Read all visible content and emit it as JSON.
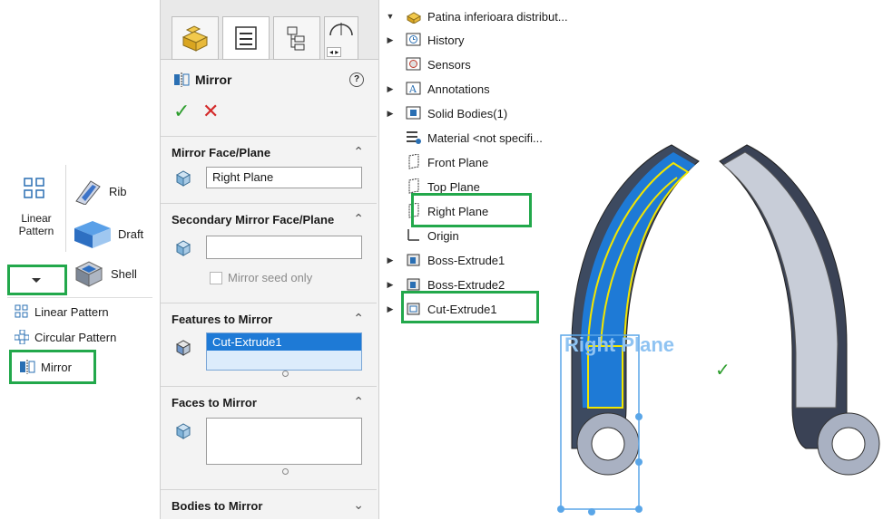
{
  "toolbar": {
    "linear_pattern_caption": "Linear\nPattern",
    "rib_label": "Rib",
    "draft_label": "Draft",
    "shell_label": "Shell",
    "menu": [
      "Linear Pattern",
      "Circular Pattern",
      "Mirror"
    ]
  },
  "property_manager": {
    "title": "Mirror",
    "help_glyph": "?",
    "mirror_face_plane": {
      "header": "Mirror Face/Plane",
      "value": "Right Plane"
    },
    "secondary_mirror": {
      "header": "Secondary Mirror Face/Plane",
      "value": "",
      "checkbox_label": "Mirror seed only"
    },
    "features_to_mirror": {
      "header": "Features to Mirror",
      "selected": "Cut-Extrude1"
    },
    "faces_to_mirror": {
      "header": "Faces to Mirror"
    },
    "bodies_to_mirror": {
      "header": "Bodies to Mirror"
    }
  },
  "tree": {
    "root": "Patina inferioara  distribut...",
    "items": [
      {
        "label": "History",
        "expand": true,
        "icon": "history-icon"
      },
      {
        "label": "Sensors",
        "expand": false,
        "icon": "sensors-icon"
      },
      {
        "label": "Annotations",
        "expand": true,
        "icon": "annotations-icon"
      },
      {
        "label": "Solid Bodies(1)",
        "expand": true,
        "icon": "solid-bodies-icon"
      },
      {
        "label": "Material <not specifi...",
        "expand": false,
        "icon": "material-icon"
      },
      {
        "label": "Front Plane",
        "expand": false,
        "icon": "plane-icon"
      },
      {
        "label": "Top Plane",
        "expand": false,
        "icon": "plane-icon"
      },
      {
        "label": "Right Plane",
        "expand": false,
        "icon": "plane-icon"
      },
      {
        "label": "Origin",
        "expand": false,
        "icon": "origin-icon"
      },
      {
        "label": "Boss-Extrude1",
        "expand": true,
        "icon": "extrude-icon"
      },
      {
        "label": "Boss-Extrude2",
        "expand": true,
        "icon": "extrude-icon"
      },
      {
        "label": "Cut-Extrude1",
        "expand": true,
        "icon": "cut-extrude-icon"
      }
    ]
  },
  "graphics": {
    "plane_label": "Right Plane",
    "accept_glyph": "✓"
  },
  "colors": {
    "highlight_green": "#22a84b",
    "selection_blue": "#1e7ad6",
    "accept_green": "#2e9e2e",
    "cancel_red": "#d42a2a"
  }
}
